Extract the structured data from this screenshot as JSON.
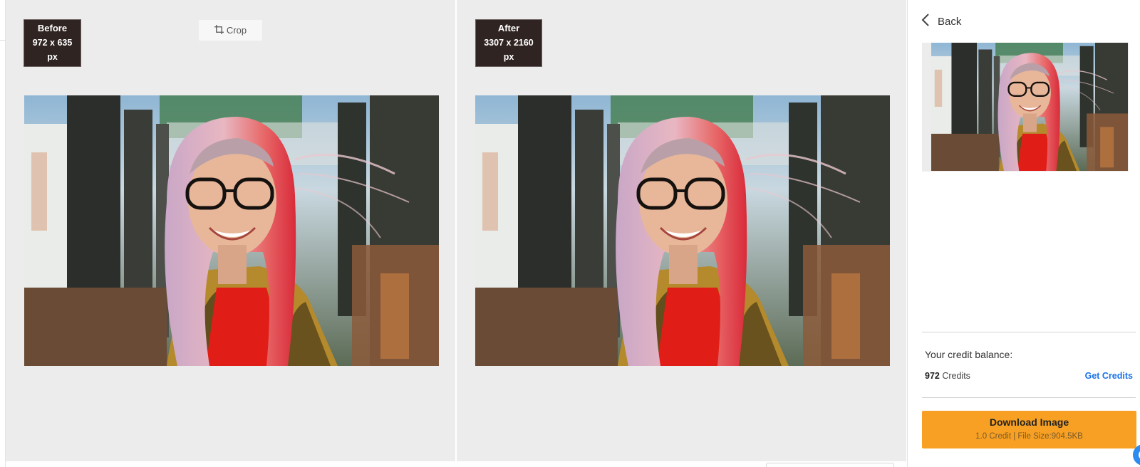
{
  "before": {
    "label": "Before",
    "dimensions": "972 x 635 px",
    "crop_label": "Crop"
  },
  "after": {
    "label": "After",
    "dimensions": "3307 x 2160 px"
  },
  "sidebar": {
    "back_label": "Back",
    "credit_label": "Your credit balance:",
    "credit_amount": "972",
    "credit_unit": "Credits",
    "get_credits_label": "Get Credits",
    "download_label": "Download Image",
    "download_meta": "1.0 Credit | File Size:904.5KB"
  },
  "colors": {
    "accent": "#f7a023",
    "link": "#1a73e8",
    "badge_bg": "#2f2422",
    "canvas_bg": "#ececec"
  },
  "icons": {
    "crop": "crop-icon",
    "back": "chevron-left-icon",
    "help": "chat-bubble-icon"
  }
}
